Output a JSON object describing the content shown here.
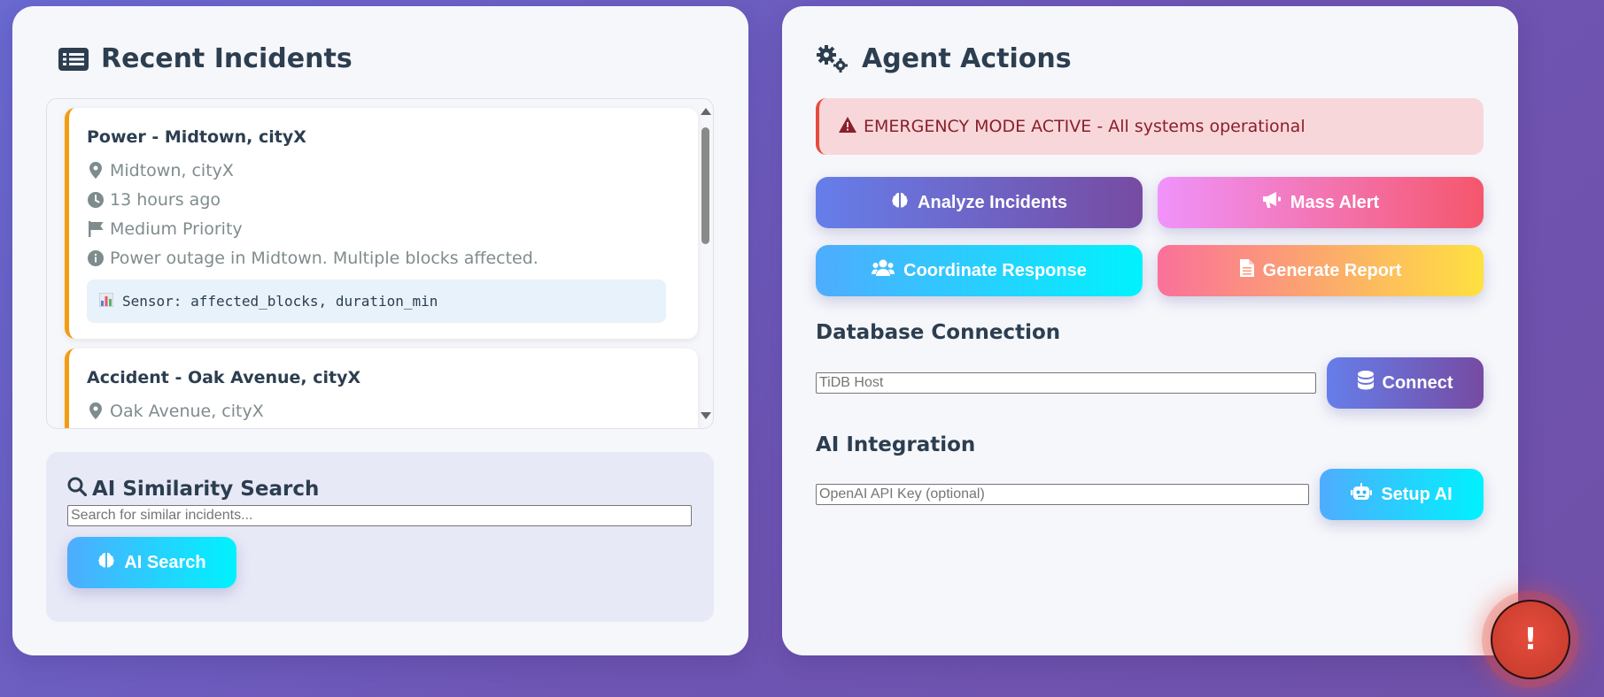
{
  "left_panel": {
    "title": "Recent Incidents",
    "title_icon": "list-icon",
    "incidents": [
      {
        "title": "Power - Midtown, cityX",
        "location": "Midtown, cityX",
        "time": "13 hours ago",
        "priority": "Medium Priority",
        "description": "Power outage in Midtown. Multiple blocks affected.",
        "sensor": "Sensor: affected_blocks, duration_min",
        "accent_color": "#f39c12"
      },
      {
        "title": "Accident - Oak Avenue, cityX",
        "location": "Oak Avenue, cityX",
        "accent_color": "#f39c12"
      }
    ],
    "search": {
      "title": "AI Similarity Search",
      "placeholder": "Search for similar incidents...",
      "button_label": "AI Search"
    }
  },
  "right_panel": {
    "title": "Agent Actions",
    "title_icon": "gears-icon",
    "emergency_banner": "EMERGENCY MODE ACTIVE - All systems operational",
    "actions": {
      "analyze": "Analyze Incidents",
      "mass_alert": "Mass Alert",
      "coordinate": "Coordinate Response",
      "report": "Generate Report"
    },
    "database": {
      "label": "Database Connection",
      "placeholder": "TiDB Host",
      "button_label": "Connect"
    },
    "ai": {
      "label": "AI Integration",
      "placeholder": "OpenAI API Key (optional)",
      "button_label": "Setup AI"
    }
  },
  "emergency_fab": {
    "label": "!",
    "color": "#e74c3c"
  },
  "colors": {
    "background_start": "#6a6ad2",
    "background_end": "#7050a8",
    "panel": "#f6f7fb",
    "text_dark": "#2c3e50",
    "text_muted": "#7f8c8d",
    "priority_medium": "#f39c12",
    "danger": "#e74c3c"
  }
}
